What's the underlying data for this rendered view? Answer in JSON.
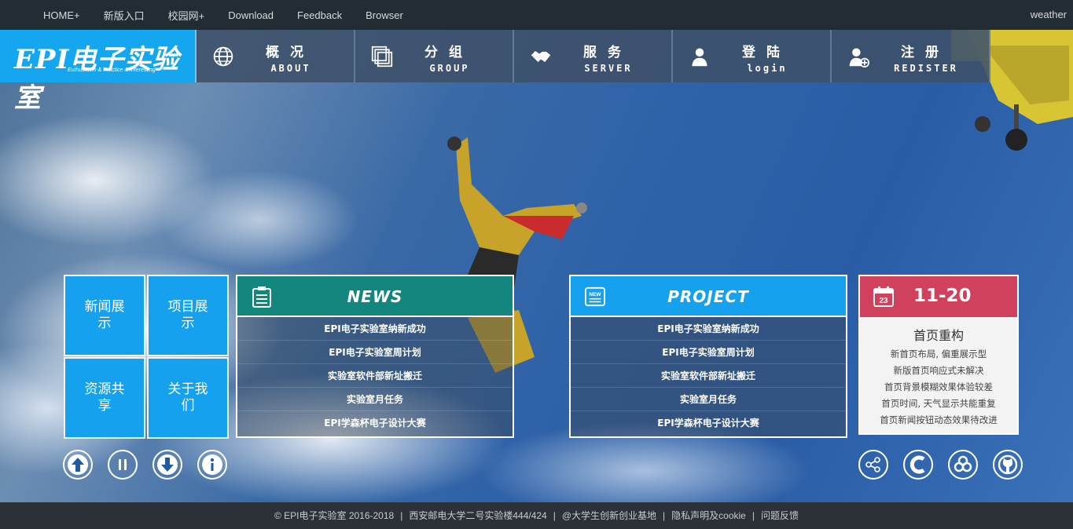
{
  "topbar": {
    "links": [
      "HOME+",
      "新版入口",
      "校园网+",
      "Download",
      "Feedback",
      "Browser"
    ],
    "weather": "weather"
  },
  "logo": {
    "title": "EPI电子实验室",
    "subtitle": "Euthusiasm & Practice & Interesting"
  },
  "menu": [
    {
      "cn": "概况",
      "en": "ABOUT",
      "icon": "globe-icon"
    },
    {
      "cn": "分组",
      "en": "GROUP",
      "icon": "layers-icon"
    },
    {
      "cn": "服务",
      "en": "SERVER",
      "icon": "handshake-icon"
    },
    {
      "cn": "登陆",
      "en": "login",
      "icon": "user-icon"
    },
    {
      "cn": "注册",
      "en": "REDISTER",
      "icon": "add-user-icon"
    }
  ],
  "tiles": [
    {
      "label": "新闻展示"
    },
    {
      "label": "项目展示"
    },
    {
      "label": "资源共享"
    },
    {
      "label": "关于我们"
    }
  ],
  "news": {
    "title": "NEWS",
    "items": [
      "EPI电子实验室纳新成功",
      "EPI电子实验室周计划",
      "实验室软件部新址搬迁",
      "实验室月任务",
      "EPI学森杯电子设计大赛"
    ]
  },
  "project": {
    "title": "PROJECT",
    "items": [
      "EPI电子实验室纳新成功",
      "EPI电子实验室周计划",
      "实验室软件部新址搬迁",
      "实验室月任务",
      "EPI学森杯电子设计大赛"
    ]
  },
  "calendar": {
    "day_number": "23",
    "date": "11-20",
    "title": "首页重构",
    "lines": [
      "新首页布局, 偏重展示型",
      "新版首页响应式未解决",
      "首页背景模糊效果体验较差",
      "首页时间, 天气显示共能重复",
      "首页新闻按钮动态效果待改进"
    ]
  },
  "footer": {
    "copyright": "© EPI电子实验室 2016-2018",
    "address": "西安邮电大学二号实验楼444/424",
    "base": "@大学生创新创业基地",
    "privacy": "隐私声明及cookie",
    "feedback": "问题反馈"
  },
  "colors": {
    "accent_blue": "#16a1ef",
    "news_teal": "#13877e",
    "calendar_red": "#d0415d",
    "topbar": "#222c33",
    "footer": "#2b3136"
  }
}
